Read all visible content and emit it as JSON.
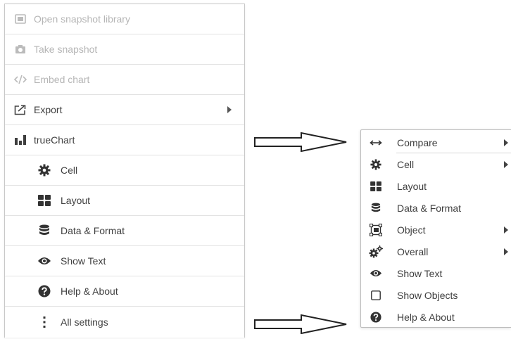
{
  "left_menu": {
    "items": [
      {
        "label": "Open snapshot library",
        "icon": "snapshot-library-icon",
        "disabled": true
      },
      {
        "label": "Take snapshot",
        "icon": "camera-icon",
        "disabled": true
      },
      {
        "label": "Embed chart",
        "icon": "code-icon",
        "disabled": true
      },
      {
        "label": "Export",
        "icon": "export-icon",
        "submenu": true
      },
      {
        "label": "trueChart",
        "icon": "bar-chart-icon"
      },
      {
        "label": "Cell",
        "icon": "gear-icon"
      },
      {
        "label": "Layout",
        "icon": "grid-icon"
      },
      {
        "label": "Data & Format",
        "icon": "database-icon"
      },
      {
        "label": "Show Text",
        "icon": "eye-icon"
      },
      {
        "label": "Help & About",
        "icon": "help-icon"
      },
      {
        "label": "All settings",
        "icon": "more-vertical-icon"
      }
    ]
  },
  "right_menu": {
    "items": [
      {
        "label": "Compare",
        "icon": "arrows-horizontal-icon",
        "submenu": true
      },
      {
        "label": "Cell",
        "icon": "gear-icon",
        "submenu": true
      },
      {
        "label": "Layout",
        "icon": "grid-icon"
      },
      {
        "label": "Data & Format",
        "icon": "database-icon"
      },
      {
        "label": "Object",
        "icon": "object-icon",
        "submenu": true
      },
      {
        "label": "Overall",
        "icon": "gears-icon",
        "submenu": true
      },
      {
        "label": "Show Text",
        "icon": "eye-icon"
      },
      {
        "label": "Show Objects",
        "icon": "checkbox-icon"
      },
      {
        "label": "Help & About",
        "icon": "help-icon"
      }
    ]
  }
}
